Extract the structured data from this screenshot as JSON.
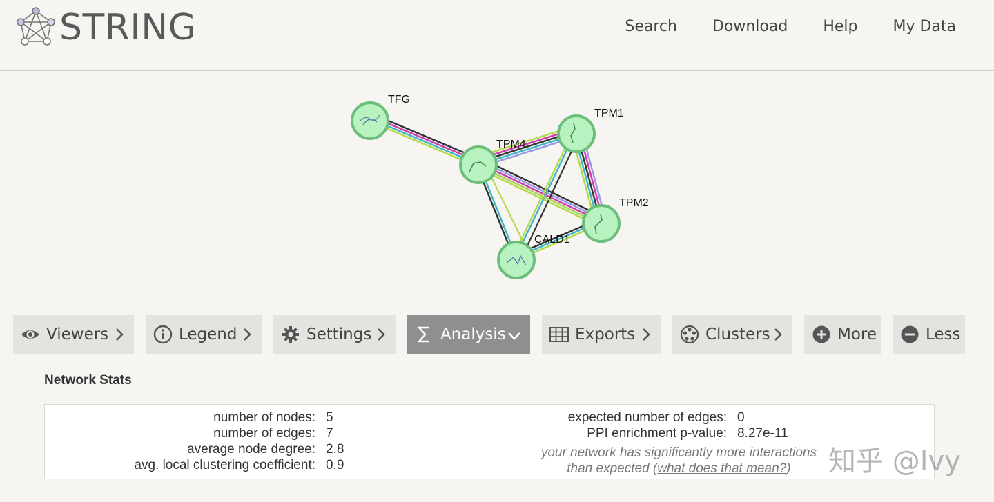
{
  "header": {
    "brand": "STRING",
    "nav": [
      "Search",
      "Download",
      "Help",
      "My Data"
    ]
  },
  "network": {
    "nodes": [
      "TFG",
      "TPM4",
      "TPM1",
      "TPM2",
      "CALD1"
    ]
  },
  "toolbar": {
    "viewers": "Viewers",
    "legend": "Legend",
    "settings": "Settings",
    "analysis": "Analysis",
    "exports": "Exports",
    "clusters": "Clusters",
    "more": "More",
    "less": "Less"
  },
  "stats": {
    "title": "Network Stats",
    "nodes_label": "number of nodes:",
    "nodes_value": "5",
    "edges_label": "number of edges:",
    "edges_value": "7",
    "degree_label": "average node degree:",
    "degree_value": "2.8",
    "clustering_label": "avg. local clustering coefficient:",
    "clustering_value": "0.9",
    "expected_label": "expected number of edges:",
    "expected_value": "0",
    "ppi_label": "PPI enrichment p-value:",
    "ppi_value": "8.27e-11",
    "note_line1": "your network has significantly more interactions",
    "note_line2_prefix": "than expected (",
    "note_link": "what does that mean?",
    "note_line2_suffix": ")"
  },
  "watermark": "知乎 @Ivy",
  "colors": {
    "background": "#f6f5f1",
    "button": "#e4e3df",
    "button_active": "#8f8f8f",
    "node_fill": "#b9f2c1",
    "node_stroke": "#6cbf7a"
  }
}
